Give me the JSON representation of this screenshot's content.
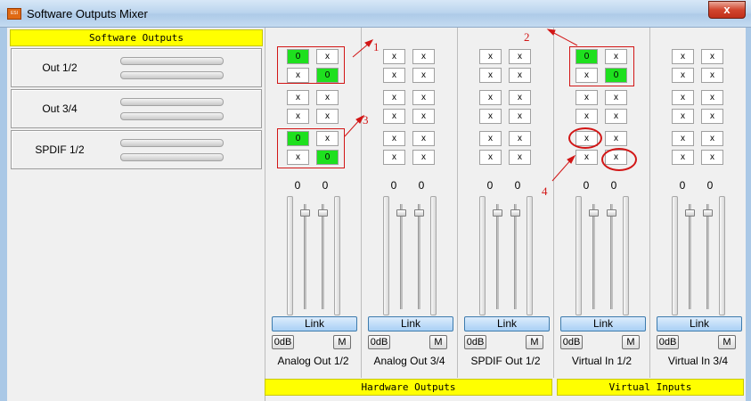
{
  "window": {
    "title": "Software Outputs Mixer",
    "app_icon_text": "ESI",
    "close_glyph": "x"
  },
  "software_outputs": {
    "header": "Software Outputs",
    "groups": [
      {
        "label": "Out 1/2"
      },
      {
        "label": "Out 3/4"
      },
      {
        "label": "SPDIF 1/2"
      }
    ]
  },
  "sections": {
    "hardware": "Hardware Outputs",
    "virtual": "Virtual Inputs"
  },
  "strips": [
    {
      "label": "Analog Out 1/2",
      "cells": [
        [
          "0",
          "x",
          "x",
          "0"
        ],
        [
          "x",
          "x",
          "x",
          "x"
        ],
        [
          "0",
          "x",
          "x",
          "0"
        ]
      ],
      "on": [
        [
          true,
          false,
          false,
          true
        ],
        [
          false,
          false,
          false,
          false
        ],
        [
          true,
          false,
          false,
          true
        ]
      ],
      "levels": [
        "0",
        "0"
      ],
      "link": "Link",
      "zero_db": "0dB",
      "mute": "M"
    },
    {
      "label": "Analog Out 3/4",
      "cells": [
        [
          "x",
          "x",
          "x",
          "x"
        ],
        [
          "x",
          "x",
          "x",
          "x"
        ],
        [
          "x",
          "x",
          "x",
          "x"
        ]
      ],
      "on": [
        [
          false,
          false,
          false,
          false
        ],
        [
          false,
          false,
          false,
          false
        ],
        [
          false,
          false,
          false,
          false
        ]
      ],
      "levels": [
        "0",
        "0"
      ],
      "link": "Link",
      "zero_db": "0dB",
      "mute": "M"
    },
    {
      "label": "SPDIF Out 1/2",
      "cells": [
        [
          "x",
          "x",
          "x",
          "x"
        ],
        [
          "x",
          "x",
          "x",
          "x"
        ],
        [
          "x",
          "x",
          "x",
          "x"
        ]
      ],
      "on": [
        [
          false,
          false,
          false,
          false
        ],
        [
          false,
          false,
          false,
          false
        ],
        [
          false,
          false,
          false,
          false
        ]
      ],
      "levels": [
        "0",
        "0"
      ],
      "link": "Link",
      "zero_db": "0dB",
      "mute": "M"
    },
    {
      "label": "Virtual In 1/2",
      "cells": [
        [
          "0",
          "x",
          "x",
          "0"
        ],
        [
          "x",
          "x",
          "x",
          "x"
        ],
        [
          "x",
          "x",
          "x",
          "x"
        ]
      ],
      "on": [
        [
          true,
          false,
          false,
          true
        ],
        [
          false,
          false,
          false,
          false
        ],
        [
          false,
          false,
          false,
          false
        ]
      ],
      "levels": [
        "0",
        "0"
      ],
      "link": "Link",
      "zero_db": "0dB",
      "mute": "M"
    },
    {
      "label": "Virtual In 3/4",
      "cells": [
        [
          "x",
          "x",
          "x",
          "x"
        ],
        [
          "x",
          "x",
          "x",
          "x"
        ],
        [
          "x",
          "x",
          "x",
          "x"
        ]
      ],
      "on": [
        [
          false,
          false,
          false,
          false
        ],
        [
          false,
          false,
          false,
          false
        ],
        [
          false,
          false,
          false,
          false
        ]
      ],
      "levels": [
        "0",
        "0"
      ],
      "link": "Link",
      "zero_db": "0dB",
      "mute": "M"
    }
  ],
  "annotations": [
    "1",
    "2",
    "3",
    "4"
  ],
  "colors": {
    "active_cell": "#1ee01e",
    "section_header": "#ffff00",
    "annotation": "#d21616",
    "link_button": "#a9d0f5"
  }
}
